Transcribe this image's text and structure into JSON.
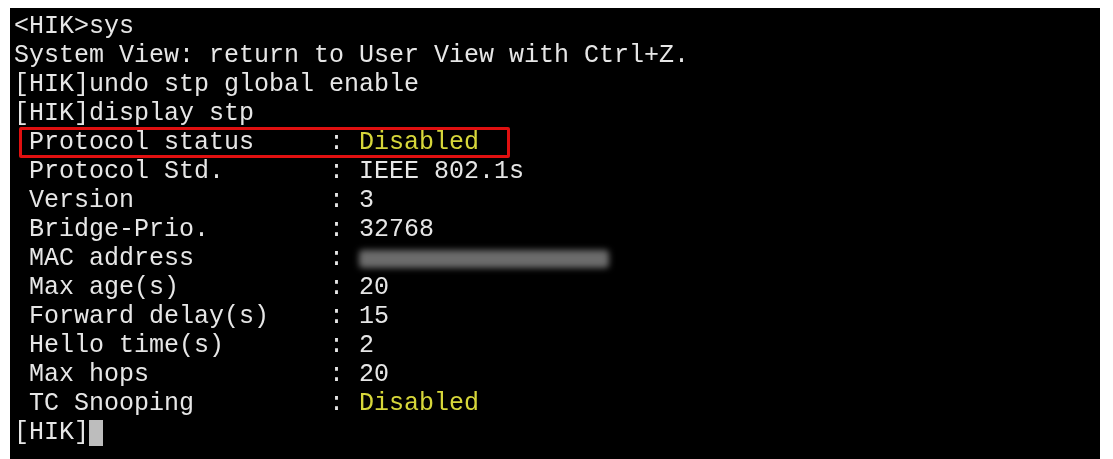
{
  "terminal": {
    "lines": [
      {
        "kind": "command",
        "text": "<HIK>sys"
      },
      {
        "kind": "output",
        "text": "System View: return to User View with Ctrl+Z."
      },
      {
        "kind": "command",
        "text": "[HIK]undo stp global enable"
      },
      {
        "kind": "command",
        "text": "[HIK]display stp"
      },
      {
        "kind": "field",
        "label": "Protocol status",
        "sep": ":",
        "value": "Disabled",
        "color": "#d7d73a",
        "boxed": true
      },
      {
        "kind": "field",
        "label": "Protocol Std.",
        "sep": ":",
        "value": "IEEE 802.1s",
        "color": "#e6e6e6",
        "boxed": false
      },
      {
        "kind": "field",
        "label": "Version",
        "sep": ":",
        "value": "3",
        "color": "#e6e6e6",
        "boxed": false
      },
      {
        "kind": "field",
        "label": "Bridge-Prio.",
        "sep": ":",
        "value": "32768",
        "color": "#e6e6e6",
        "boxed": false
      },
      {
        "kind": "redacted",
        "label": "MAC address",
        "sep": ":"
      },
      {
        "kind": "field",
        "label": "Max age(s)",
        "sep": ":",
        "value": "20",
        "color": "#e6e6e6",
        "boxed": false
      },
      {
        "kind": "field",
        "label": "Forward delay(s)",
        "sep": ":",
        "value": "15",
        "color": "#e6e6e6",
        "boxed": false
      },
      {
        "kind": "field",
        "label": "Hello time(s)",
        "sep": ":",
        "value": "2",
        "color": "#e6e6e6",
        "boxed": false
      },
      {
        "kind": "field",
        "label": "Max hops",
        "sep": ":",
        "value": "20",
        "color": "#e6e6e6",
        "boxed": false
      },
      {
        "kind": "field",
        "label": "TC Snooping",
        "sep": ":",
        "value": "Disabled",
        "color": "#d7d73a",
        "boxed": false
      },
      {
        "kind": "prompt",
        "text": "[HIK]"
      }
    ]
  }
}
